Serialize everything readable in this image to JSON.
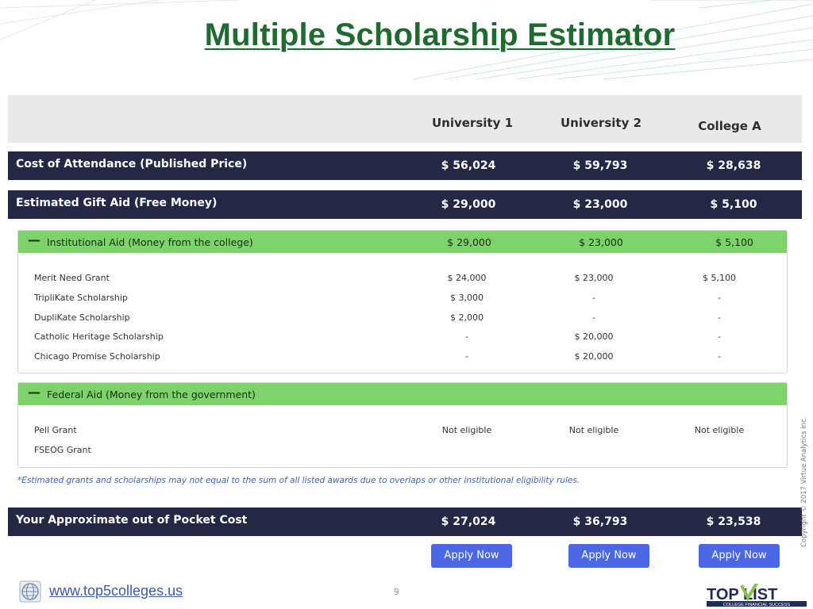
{
  "title": "Multiple Scholarship Estimator",
  "columns": [
    "University 1",
    "University 2",
    "College A"
  ],
  "cost_of_attendance": {
    "label": "Cost of Attendance (Published Price)",
    "values": [
      "$ 56,024",
      "$ 59,793",
      "$ 28,638"
    ]
  },
  "gift_aid": {
    "label": "Estimated Gift Aid (Free Money)",
    "values": [
      "$ 29,000",
      "$ 23,000",
      "$ 5,100"
    ]
  },
  "institutional": {
    "label": "Institutional Aid (Money from the college)",
    "values": [
      "$ 29,000",
      "$ 23,000",
      "$ 5,100"
    ],
    "rows": [
      {
        "label": "Merit Need Grant",
        "values": [
          "$ 24,000",
          "$ 23,000",
          "$ 5,100"
        ]
      },
      {
        "label": "TripliKate Scholarship",
        "values": [
          "$ 3,000",
          "-",
          "-"
        ]
      },
      {
        "label": "DupliKate Scholarship",
        "values": [
          "$ 2,000",
          "-",
          "-"
        ]
      },
      {
        "label": "Catholic Heritage Scholarship",
        "values": [
          "-",
          "$ 20,000",
          "-"
        ]
      },
      {
        "label": "Chicago Promise Scholarship",
        "values": [
          "-",
          "$ 20,000",
          "-"
        ]
      }
    ]
  },
  "federal": {
    "label": "Federal Aid (Money from the government)",
    "rows": [
      {
        "label": "Pell Grant",
        "values": [
          "Not eligible",
          "Not eligible",
          "Not eligible"
        ]
      },
      {
        "label": "FSEOG Grant",
        "values": [
          "",
          "",
          ""
        ]
      }
    ]
  },
  "note": "*Estimated grants and scholarships may not equal to the sum of all listed awards due to overlaps or other institutional eligibility rules.",
  "out_of_pocket": {
    "label": "Your Approximate out of Pocket Cost",
    "values": [
      "$ 27,024",
      "$ 36,793",
      "$ 23,538"
    ]
  },
  "apply_label": "Apply Now",
  "footer": {
    "url": "www.top5colleges.us",
    "page": "9",
    "logo_text": "TOP LIST",
    "logo_tagline": "COLLEGE FINANCIAL SUCCESS"
  },
  "copyright": "Copyright © 2017 Virtue Analytics Inc."
}
